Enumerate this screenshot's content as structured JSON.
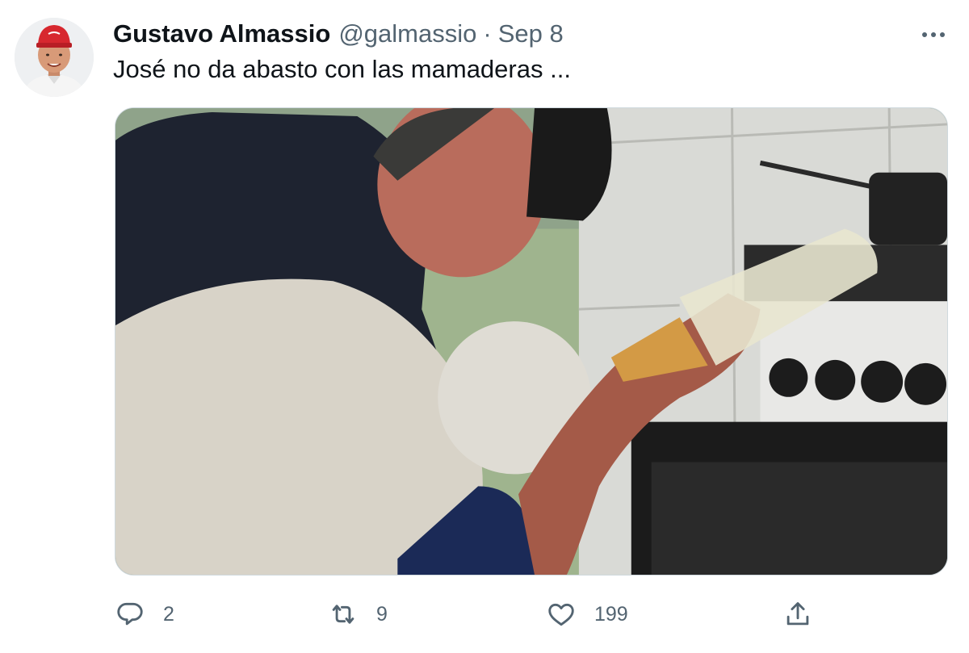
{
  "author": {
    "display_name": "Gustavo Almassio",
    "handle": "@galmassio",
    "separator": "·",
    "date": "Sep 8"
  },
  "tweet": {
    "text": "José no da abasto con las mamaderas ..."
  },
  "actions": {
    "reply_count": "2",
    "retweet_count": "9",
    "like_count": "199"
  },
  "icons": {
    "more": "more-horizontal-icon",
    "reply": "speech-bubble-icon",
    "retweet": "retweet-arrows-icon",
    "like": "heart-outline-icon",
    "share": "share-upload-icon"
  },
  "colors": {
    "text_primary": "#0f1419",
    "text_secondary": "#536471",
    "border": "#cfd9de"
  }
}
